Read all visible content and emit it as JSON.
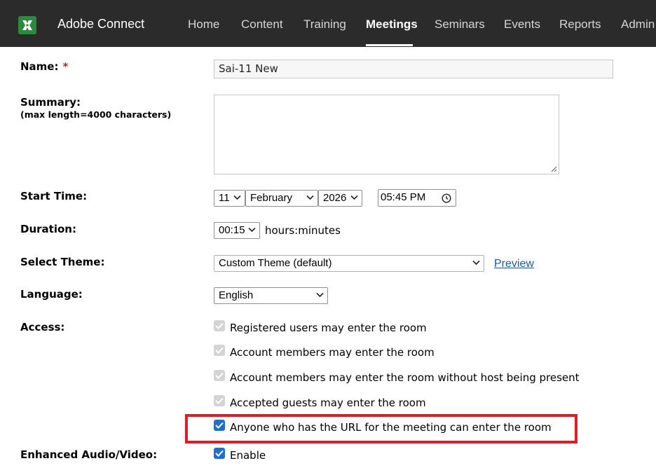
{
  "app": {
    "title": "Adobe Connect",
    "logo_icon": "adobe-connect-logo-icon",
    "brand_color": "#2c8a3f"
  },
  "nav": {
    "items": [
      {
        "label": "Home",
        "active": false
      },
      {
        "label": "Content",
        "active": false
      },
      {
        "label": "Training",
        "active": false
      },
      {
        "label": "Meetings",
        "active": true
      },
      {
        "label": "Seminars",
        "active": false
      },
      {
        "label": "Events",
        "active": false
      },
      {
        "label": "Reports",
        "active": false
      },
      {
        "label": "Admin",
        "active": false
      }
    ]
  },
  "form": {
    "name": {
      "label": "Name:",
      "required_marker": "*",
      "value": "Sai-11 New"
    },
    "summary": {
      "label": "Summary:",
      "hint": "(max length=4000 characters)",
      "value": ""
    },
    "start_time": {
      "label": "Start Time:",
      "day": "11",
      "month": "February",
      "year": "2026",
      "time": "05:45 PM"
    },
    "duration": {
      "label": "Duration:",
      "value": "00:15",
      "unit_text": "hours:minutes"
    },
    "theme": {
      "label": "Select Theme:",
      "value": "Custom Theme (default)",
      "preview_link": "Preview"
    },
    "language": {
      "label": "Language:",
      "value": "English"
    },
    "access": {
      "label": "Access:",
      "options": [
        {
          "label": "Registered users may enter the room",
          "checked": true,
          "disabled": true
        },
        {
          "label": "Account members may enter the room",
          "checked": true,
          "disabled": true
        },
        {
          "label": "Account members may enter the room without host being present",
          "checked": true,
          "disabled": true
        },
        {
          "label": "Accepted guests may enter the room",
          "checked": true,
          "disabled": true
        },
        {
          "label": "Anyone who has the URL for the meeting can enter the room",
          "checked": true,
          "disabled": false
        }
      ]
    },
    "enhanced_av": {
      "label": "Enhanced Audio/Video:",
      "option_label": "Enable",
      "checked": true
    }
  },
  "colors": {
    "topbar": "#2b2b2b",
    "checkbox_accent": "#1f6fd1",
    "highlight_border": "#e11c24",
    "link": "#1d5ba8",
    "required": "#cc1f1f"
  }
}
